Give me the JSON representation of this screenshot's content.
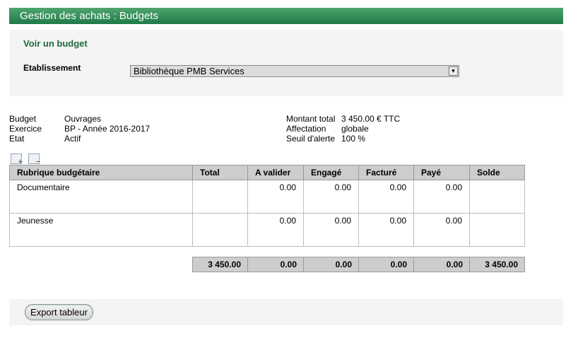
{
  "page_title": "Gestion des achats : Budgets",
  "form": {
    "title": "Voir un budget",
    "etablissement_label": "Etablissement",
    "etablissement_value": "Bibliothèque PMB Services"
  },
  "info": {
    "left": [
      {
        "key": "Budget",
        "value": "Ouvrages"
      },
      {
        "key": "Exercice",
        "value": "BP - Année 2016-2017"
      },
      {
        "key": "Etat",
        "value": "Actif"
      }
    ],
    "right": [
      {
        "key": "Montant total",
        "value": "3 450.00 € TTC"
      },
      {
        "key": "Affectation",
        "value": "globale"
      },
      {
        "key": "Seuil d'alerte",
        "value": "100 %"
      }
    ]
  },
  "icons": [
    "expand-all-icon",
    "collapse-all-icon"
  ],
  "table": {
    "headers": [
      "Rubrique budgétaire",
      "Total",
      "A valider",
      "Engagé",
      "Facturé",
      "Payé",
      "Solde"
    ],
    "rows": [
      [
        "Documentaire",
        "",
        "0.00",
        "0.00",
        "0.00",
        "0.00",
        ""
      ],
      [
        "Jeunesse",
        "",
        "0.00",
        "0.00",
        "0.00",
        "0.00",
        ""
      ]
    ],
    "totals": [
      "3 450.00",
      "0.00",
      "0.00",
      "0.00",
      "0.00",
      "3 450.00"
    ]
  },
  "footer": {
    "export_label": "Export tableur"
  },
  "colors": {
    "title_bar": "#2e8b57",
    "accent_text": "#1f6b3f",
    "header_bg": "#cdcdcd"
  }
}
